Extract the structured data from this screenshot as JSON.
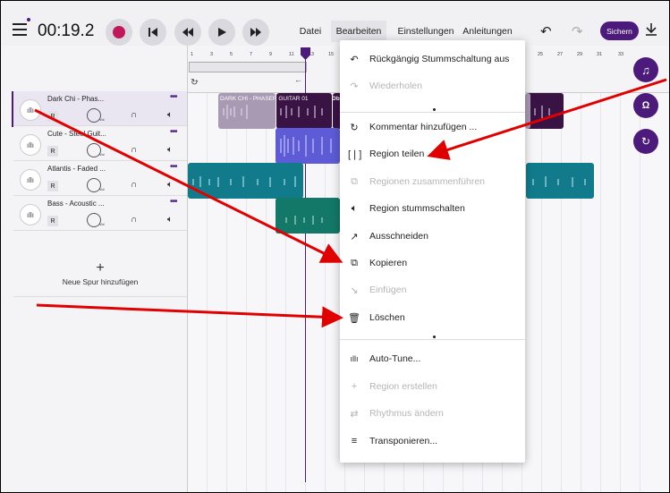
{
  "topbar": {
    "time": "00:19.2",
    "menu": {
      "datei": "Datei",
      "bearbeiten": "Bearbeiten",
      "einstellungen": "Einstellungen",
      "anleitungen": "Anleitungen"
    },
    "save_label": "Sichern"
  },
  "ruler": {
    "ticks": [
      "1",
      "3",
      "5",
      "7",
      "9",
      "11",
      "13",
      "15",
      "17",
      "19",
      "21",
      "23",
      "25",
      "27",
      "29",
      "31",
      "33"
    ]
  },
  "tracks": [
    {
      "name": "Dark Chi - Phas...",
      "r": "R",
      "vol": "Vol"
    },
    {
      "name": "Cute - Steel Guit...",
      "r": "R",
      "vol": "Vol"
    },
    {
      "name": "Atlantis - Faded ...",
      "r": "R",
      "vol": "Vol"
    },
    {
      "name": "Bass - Acoustic ...",
      "r": "R",
      "vol": "Vol"
    }
  ],
  "add_track_label": "Neue Spur hinzufügen",
  "region_label": "DARK CHI - PHASER GUITAR 01",
  "region_label_short": "Db",
  "dropdown": {
    "items": [
      {
        "label": "Rückgängig Stummschaltung aus",
        "enabled": true,
        "icon": "undo-icon"
      },
      {
        "label": "Wiederholen",
        "enabled": false,
        "icon": "redo-icon"
      },
      {
        "label": "Kommentar hinzufügen ...",
        "enabled": true,
        "icon": "comment-icon"
      },
      {
        "label": "Region teilen",
        "enabled": true,
        "icon": "split-icon"
      },
      {
        "label": "Regionen zusammenführen",
        "enabled": false,
        "icon": "merge-icon"
      },
      {
        "label": "Region stummschalten",
        "enabled": true,
        "icon": "mute-icon"
      },
      {
        "label": "Ausschneiden",
        "enabled": true,
        "icon": "cut-icon"
      },
      {
        "label": "Kopieren",
        "enabled": true,
        "icon": "copy-icon"
      },
      {
        "label": "Einfügen",
        "enabled": false,
        "icon": "paste-icon"
      },
      {
        "label": "Löschen",
        "enabled": true,
        "icon": "delete-icon"
      },
      {
        "label": "Auto-Tune...",
        "enabled": true,
        "icon": "autotune-icon"
      },
      {
        "label": "Region erstellen",
        "enabled": false,
        "icon": "plus-icon"
      },
      {
        "label": "Rhythmus ändern",
        "enabled": false,
        "icon": "shuffle-icon"
      },
      {
        "label": "Transponieren...",
        "enabled": true,
        "icon": "transpose-icon"
      }
    ]
  },
  "colors": {
    "accent": "#4c1a7a",
    "record": "#c2185b",
    "arrow": "#e00000",
    "track1_region": "#3a1345",
    "track1_region_light": "#a99ab4",
    "track2_region": "#5d5cd6",
    "track3_region": "#117b8c",
    "track4_region": "#137867"
  }
}
